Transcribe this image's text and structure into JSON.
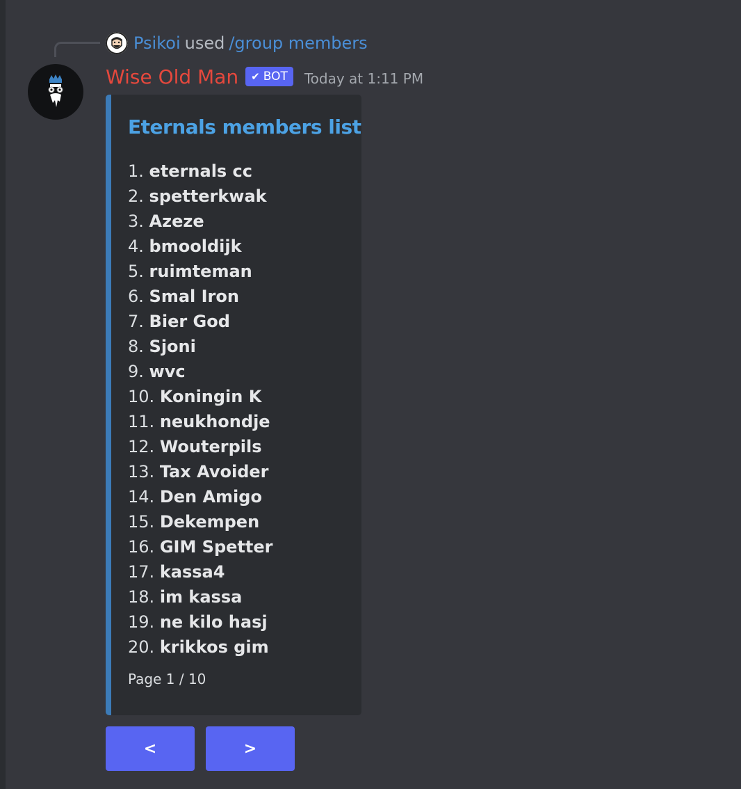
{
  "reply": {
    "user": "Psikoi",
    "used_text": "used",
    "command": "/group members"
  },
  "message": {
    "author": "Wise Old Man",
    "badge": "BOT",
    "timestamp": "Today at 1:11 PM"
  },
  "embed": {
    "title": "Eternals members list",
    "accent_color": "#3c7bb8",
    "members": [
      {
        "num": "1.",
        "name": "eternals cc"
      },
      {
        "num": "2.",
        "name": "spetterkwak"
      },
      {
        "num": "3.",
        "name": "Azeze"
      },
      {
        "num": "4.",
        "name": "bmooldijk"
      },
      {
        "num": "5.",
        "name": "ruimteman"
      },
      {
        "num": "6.",
        "name": "Smal Iron"
      },
      {
        "num": "7.",
        "name": "Bier God"
      },
      {
        "num": "8.",
        "name": "Sjoni"
      },
      {
        "num": "9.",
        "name": "wvc"
      },
      {
        "num": "10.",
        "name": "Koningin K"
      },
      {
        "num": "11.",
        "name": "neukhondje"
      },
      {
        "num": "12.",
        "name": "Wouterpils"
      },
      {
        "num": "13.",
        "name": "Tax Avoider"
      },
      {
        "num": "14.",
        "name": "Den Amigo"
      },
      {
        "num": "15.",
        "name": "Dekempen"
      },
      {
        "num": "16.",
        "name": "GIM Spetter"
      },
      {
        "num": "17.",
        "name": "kassa4"
      },
      {
        "num": "18.",
        "name": "im kassa"
      },
      {
        "num": "19.",
        "name": "ne kilo hasj"
      },
      {
        "num": "20.",
        "name": "krikkos gim"
      }
    ],
    "footer": "Page 1 / 10"
  },
  "buttons": {
    "prev_label": "<",
    "next_label": ">"
  },
  "colors": {
    "author": "#e5483d",
    "link": "#4a8ed6",
    "blurple": "#5865f2"
  }
}
